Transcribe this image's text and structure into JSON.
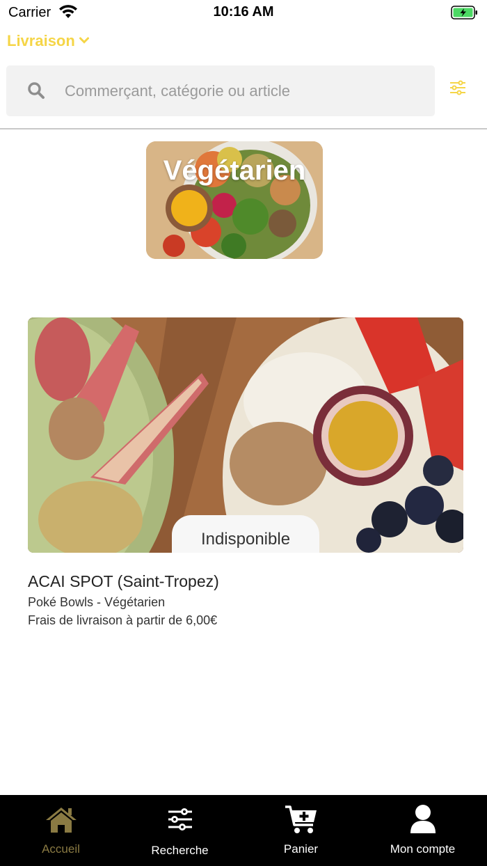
{
  "status_bar": {
    "carrier": "Carrier",
    "time": "10:16 AM"
  },
  "header": {
    "mode_label": "Livraison",
    "mode_icon": "chevron-down-icon"
  },
  "search": {
    "placeholder": "Commerçant, catégorie ou article",
    "value": "",
    "icon": "search-icon",
    "filter_icon": "sliders-icon"
  },
  "category": {
    "title": "Végétarien"
  },
  "merchant": {
    "status": "Indisponible",
    "name": "ACAI SPOT (Saint-Tropez)",
    "categories": "Poké Bowls - Végétarien",
    "delivery_fee": "Frais de livraison à partir de 6,00€"
  },
  "tabs": [
    {
      "label": "Accueil",
      "icon": "home-icon",
      "active": true
    },
    {
      "label": "Recherche",
      "icon": "sliders-icon",
      "active": false
    },
    {
      "label": "Panier",
      "icon": "cart-icon",
      "active": false
    },
    {
      "label": "Mon compte",
      "icon": "user-icon",
      "active": false
    }
  ],
  "colors": {
    "accent": "#f5d547",
    "active_tab": "#8a7a43",
    "tab_bar": "#000000"
  }
}
